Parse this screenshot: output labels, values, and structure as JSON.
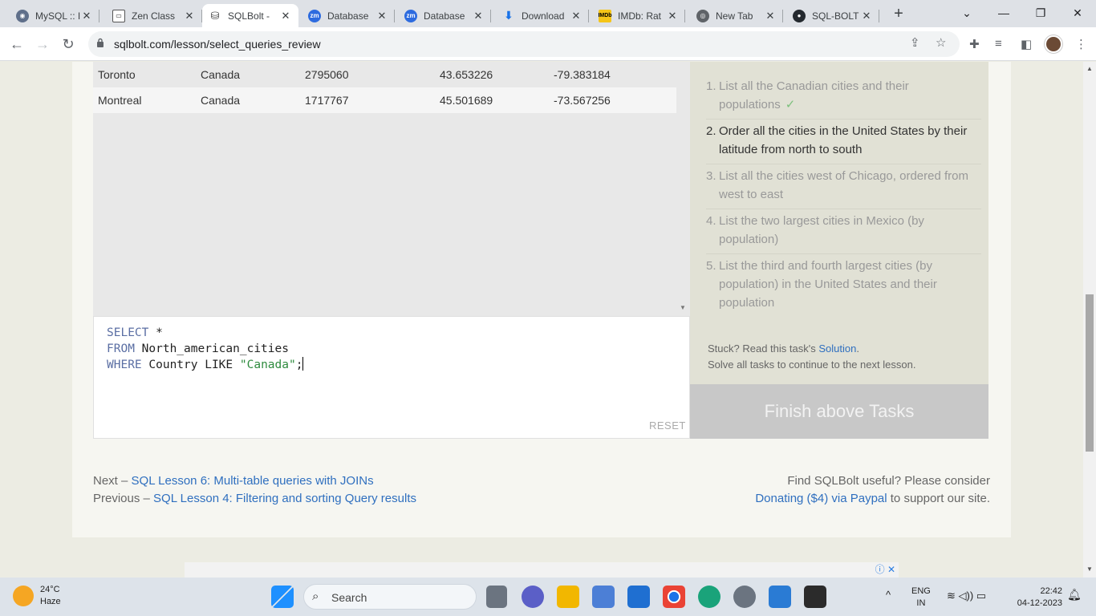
{
  "browser": {
    "tabs": [
      {
        "title": "MySQL :: I",
        "icon": "mysql-icon",
        "active": false
      },
      {
        "title": "Zen Class",
        "icon": "zen-class-icon",
        "active": false
      },
      {
        "title": "SQLBolt -",
        "icon": "database-icon",
        "active": true
      },
      {
        "title": "Database",
        "icon": "zoom-icon",
        "active": false
      },
      {
        "title": "Database",
        "icon": "zoom-icon",
        "active": false
      },
      {
        "title": "Download",
        "icon": "download-icon",
        "active": false
      },
      {
        "title": "IMDb: Rat",
        "icon": "imdb-icon",
        "active": false
      },
      {
        "title": "New Tab",
        "icon": "chrome-icon",
        "active": false
      },
      {
        "title": "SQL-BOLT",
        "icon": "github-icon",
        "active": false
      }
    ],
    "url": "sqlbolt.com/lesson/select_queries_review"
  },
  "results": {
    "rows": [
      [
        "Toronto",
        "Canada",
        "2795060",
        "43.653226",
        "-79.383184"
      ],
      [
        "Montreal",
        "Canada",
        "1717767",
        "45.501689",
        "-73.567256"
      ]
    ]
  },
  "editor": {
    "line1_kw": "SELECT",
    "line1_rest": " *",
    "line2_kw": "FROM",
    "line2_rest": " North_american_cities",
    "line3_kw": "WHERE",
    "line3_mid": " Country LIKE ",
    "line3_str": "\"Canada\"",
    "line3_end": ";",
    "reset_label": "RESET"
  },
  "tasks": {
    "items": [
      {
        "num": "1.",
        "text": "List all the Canadian cities and their populations",
        "check": "✓"
      },
      {
        "num": "2.",
        "text": "Order all the cities in the United States by their latitude from north to south"
      },
      {
        "num": "3.",
        "text": "List all the cities west of Chicago, ordered from west to east"
      },
      {
        "num": "4.",
        "text": "List the two largest cities in Mexico (by population)"
      },
      {
        "num": "5.",
        "text": "List the third and fourth largest cities (by population) in the United States and their population"
      }
    ],
    "stuck_prefix": "Stuck? Read this task's ",
    "solution_link": "Solution",
    "stuck_suffix": ".",
    "continue_text": "Solve all tasks to continue to the next lesson.",
    "finish_label": "Finish above Tasks"
  },
  "footer": {
    "next_prefix": "Next – ",
    "next_link": "SQL Lesson 6: Multi-table queries with JOINs",
    "prev_prefix": "Previous – ",
    "prev_link": "SQL Lesson 4: Filtering and sorting Query results",
    "useful_text": "Find SQLBolt useful? Please consider",
    "donate_link": "Donating ($4) via Paypal",
    "donate_suffix": " to support our site."
  },
  "taskbar": {
    "temperature": "24°C",
    "weather": "Haze",
    "search_label": "Search",
    "lang1": "ENG",
    "lang2": "IN",
    "time": "22:42",
    "date": "04-12-2023"
  }
}
